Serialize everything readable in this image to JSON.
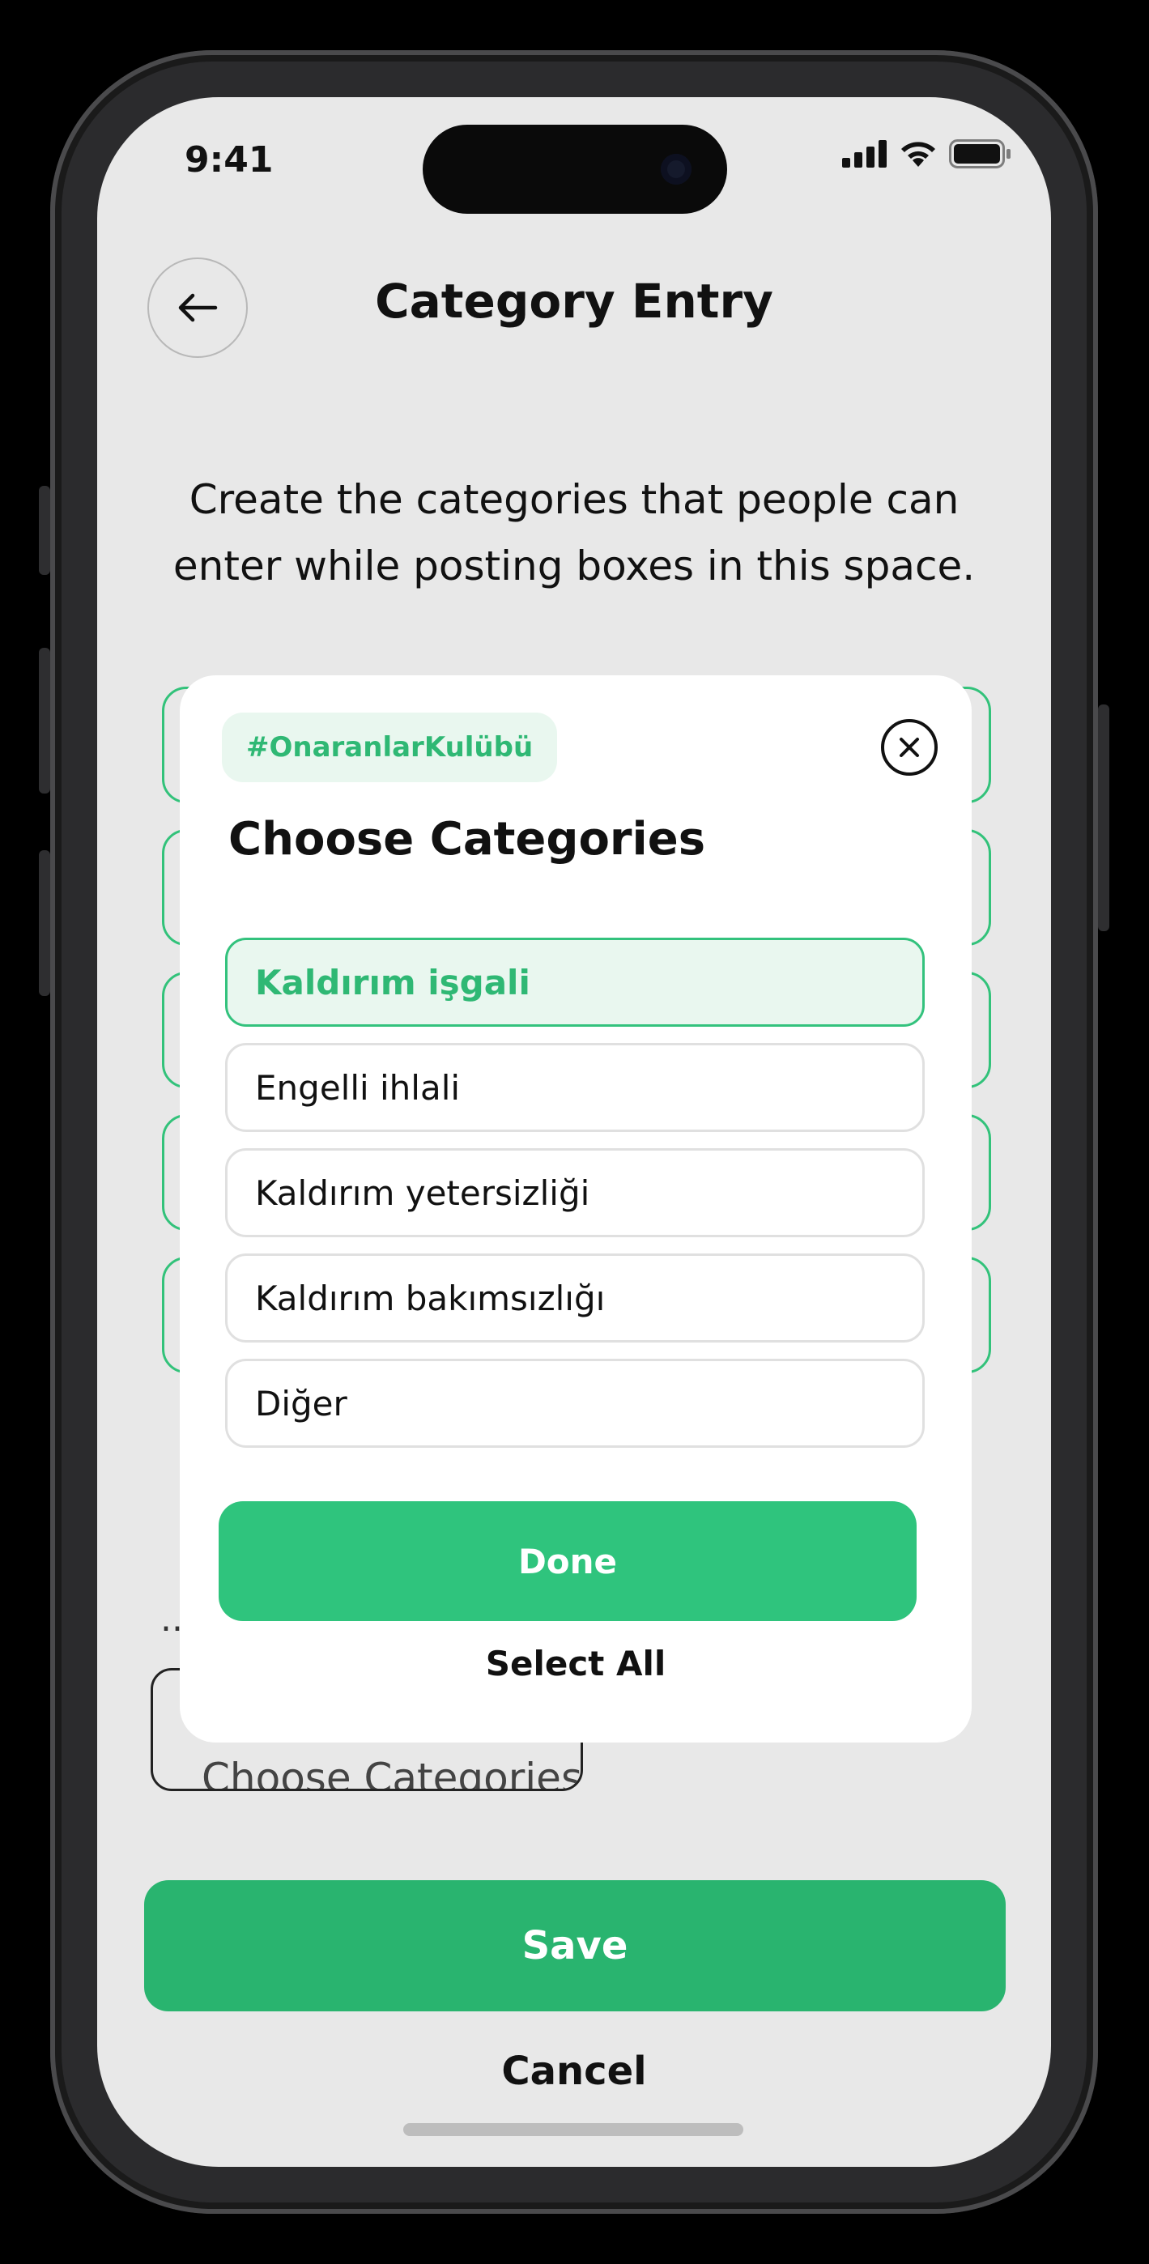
{
  "status_bar": {
    "time": "9:41"
  },
  "header": {
    "title": "Category Entry"
  },
  "description": "Create the categories that people can enter while posting boxes in this space.",
  "background": {
    "dots": "...",
    "choose_button_label": "Choose Categories"
  },
  "footer": {
    "save_label": "Save",
    "cancel_label": "Cancel"
  },
  "modal": {
    "tag": "#OnaranlarKulübü",
    "title": "Choose Categories",
    "options": [
      {
        "label": "Kaldırım işgali",
        "selected": true
      },
      {
        "label": "Engelli ihlali",
        "selected": false
      },
      {
        "label": "Kaldırım yetersizliği",
        "selected": false
      },
      {
        "label": "Kaldırım bakımsızlığı",
        "selected": false
      },
      {
        "label": "Diğer",
        "selected": false
      }
    ],
    "done_label": "Done",
    "select_all_label": "Select All"
  },
  "colors": {
    "accent": "#2fc47d",
    "save": "#29b46f",
    "screen_bg": "#e8e8e8"
  },
  "icons": {
    "back": "arrow-left-icon",
    "close": "close-circle-icon",
    "signal": "signal-icon",
    "wifi": "wifi-icon",
    "battery": "battery-icon"
  }
}
